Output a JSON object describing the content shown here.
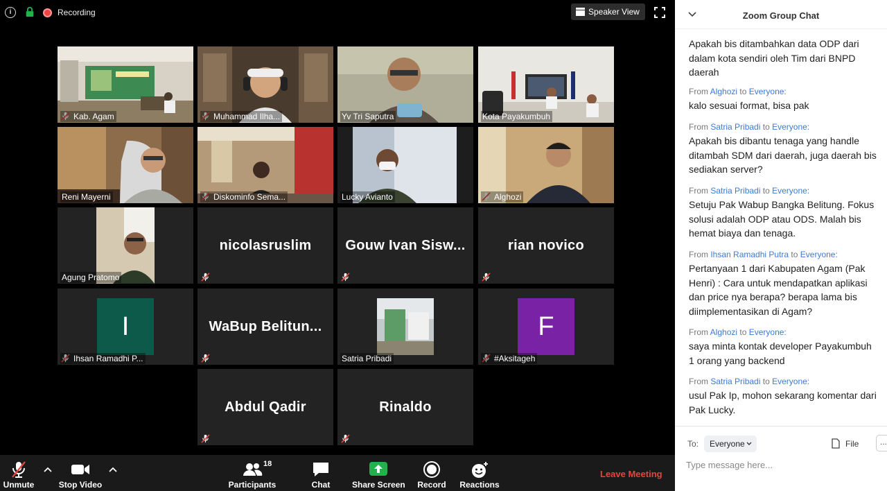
{
  "topbar": {
    "recording_label": "Recording",
    "speaker_view_label": "Speaker View"
  },
  "participants": [
    {
      "name": "Kab. Agam",
      "muted": true,
      "video": true
    },
    {
      "name": "Muhammad Ilha...",
      "muted": true,
      "video": true
    },
    {
      "name": "Yv Tri Saputra",
      "muted": false,
      "video": true
    },
    {
      "name": "Kota Payakumbuh",
      "muted": false,
      "video": true
    },
    {
      "name": "Reni Mayerni",
      "muted": false,
      "video": true
    },
    {
      "name": "Diskominfo Sema...",
      "muted": true,
      "video": true
    },
    {
      "name": "Lucky Avianto",
      "muted": false,
      "video": true,
      "active": true
    },
    {
      "name": "Alghozi",
      "muted": true,
      "video": true
    },
    {
      "name": "Agung Pratomo",
      "muted": false,
      "video": true
    },
    {
      "name": "nicolasruslim",
      "muted": true,
      "video": false
    },
    {
      "name": "Gouw Ivan Sisw...",
      "muted": true,
      "video": false
    },
    {
      "name": "rian novico",
      "muted": true,
      "video": false
    },
    {
      "name": "Ihsan Ramadhi P...",
      "muted": true,
      "avatar_letter": "I",
      "avatar_color": "#0d5a4b"
    },
    {
      "name": "WaBup Belitun...",
      "muted": true,
      "video": false
    },
    {
      "name": "Satria Pribadi",
      "muted": false,
      "video": true
    },
    {
      "name": "#Aksitageh",
      "muted": true,
      "avatar_letter": "F",
      "avatar_color": "#7a22a6"
    },
    {
      "name": "Abdul Qadir",
      "muted": true,
      "video": false
    },
    {
      "name": "Rinaldo",
      "muted": true,
      "video": false
    }
  ],
  "toolbar": {
    "unmute": "Unmute",
    "stop_video": "Stop Video",
    "participants": "Participants",
    "participants_count": "18",
    "chat": "Chat",
    "share_screen": "Share Screen",
    "record": "Record",
    "reactions": "Reactions",
    "leave": "Leave Meeting"
  },
  "chat": {
    "title": "Zoom Group Chat",
    "messages": [
      {
        "from": "",
        "to": "",
        "text": "Apakah bis ditambahkan data ODP dari dalam kota sendiri oleh Tim dari BNPD daerah"
      },
      {
        "from": "Alghozi",
        "to": "Everyone:",
        "text": "kalo sesuai format, bisa pak"
      },
      {
        "from": "Satria Pribadi",
        "to": "Everyone:",
        "text": "Apakah bis dibantu tenaga yang handle ditambah SDM dari daerah, juga daerah bis sediakan server?"
      },
      {
        "from": "Satria Pribadi",
        "to": "Everyone:",
        "text": "Setuju Pak Wabup Bangka Belitung. Fokus solusi adalah ODP atau ODS. Malah bis hemat biaya dan tenaga."
      },
      {
        "from": "Ihsan Ramadhi Putra",
        "to": "Everyone:",
        "text": "Pertanyaan 1 dari Kabupaten Agam (Pak Henri) : Cara untuk mendapatkan aplikasi dan price nya berapa? berapa lama bis diimplementasikan di Agam?"
      },
      {
        "from": "Alghozi",
        "to": "Everyone:",
        "text": "saya minta kontak developer Payakumbuh 1 orang yang backend"
      },
      {
        "from": "Satria Pribadi",
        "to": "Everyone:",
        "text": "usul Pak Ip, mohon sekarang komentar dari Pak Lucky."
      }
    ],
    "from_word": "From",
    "to_word": "to",
    "to_label": "To:",
    "recipient": "Everyone",
    "file_label": "File",
    "more_label": "...",
    "input_placeholder": "Type message here..."
  },
  "colors": {
    "active_speaker": "#c9e24a",
    "leave": "#e5463c",
    "share_screen": "#22b14c",
    "link": "#3a7bd5"
  }
}
